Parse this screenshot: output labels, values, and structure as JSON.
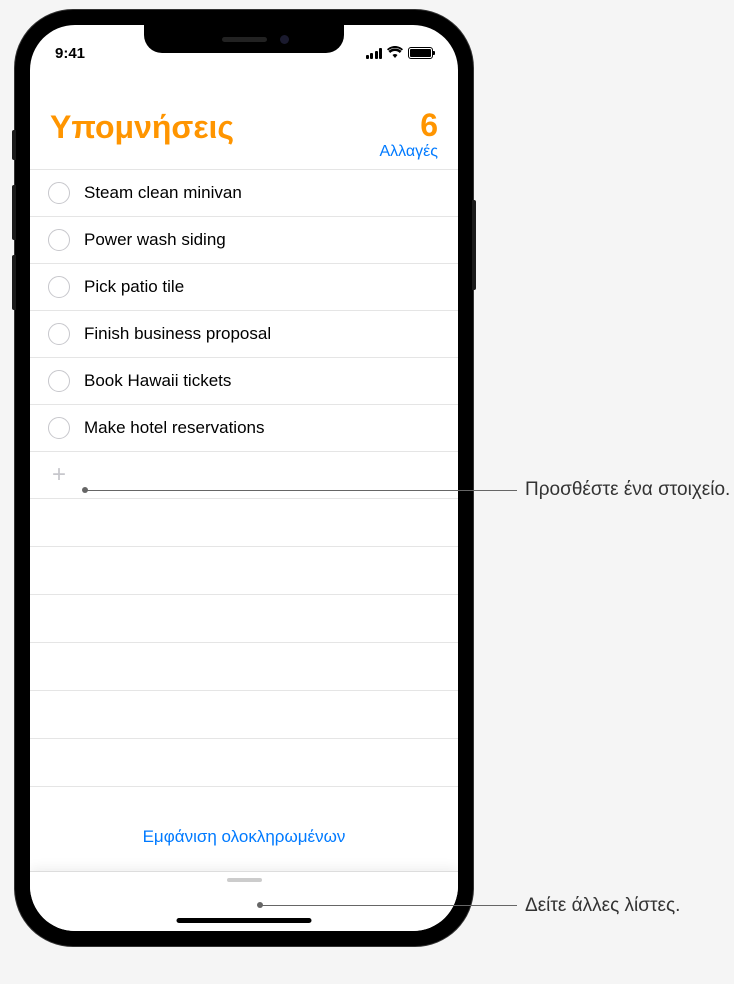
{
  "status_bar": {
    "time": "9:41"
  },
  "header": {
    "title": "Υπομνήσεις",
    "count": "6",
    "edit_label": "Αλλαγές"
  },
  "reminders": [
    {
      "text": "Steam clean minivan"
    },
    {
      "text": "Power wash siding"
    },
    {
      "text": "Pick patio tile"
    },
    {
      "text": "Finish business proposal"
    },
    {
      "text": "Book Hawaii tickets"
    },
    {
      "text": "Make hotel reservations"
    }
  ],
  "footer": {
    "show_completed": "Εμφάνιση ολοκληρωμένων"
  },
  "callouts": {
    "add_item": "Προσθέστε ένα στοιχείο.",
    "see_lists": "Δείτε άλλες λίστες."
  }
}
